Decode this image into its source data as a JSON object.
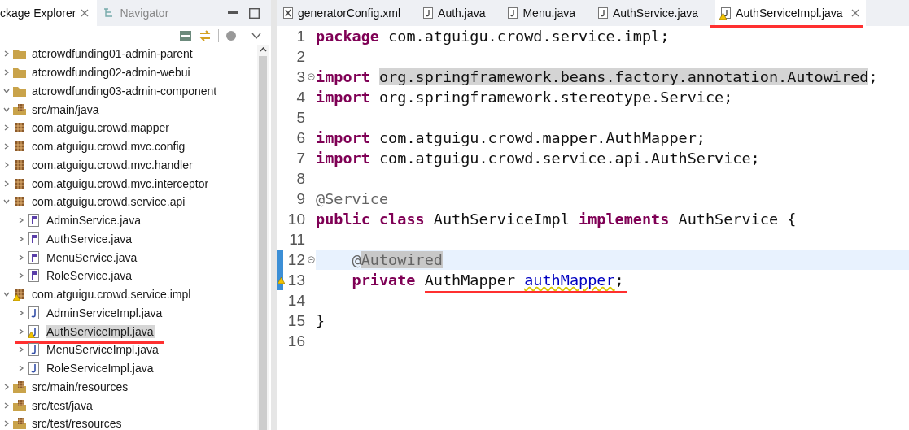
{
  "explorer": {
    "tabs": [
      {
        "label": "ckage Explorer",
        "selected": true
      },
      {
        "label": "Navigator",
        "selected": false
      }
    ],
    "tree": [
      {
        "label": "atcrowdfunding01-admin-parent",
        "kind": "project",
        "expanded": false,
        "selected": false
      },
      {
        "label": "atcrowdfunding02-admin-webui",
        "kind": "project",
        "expanded": false,
        "selected": false
      },
      {
        "label": "atcrowdfunding03-admin-component",
        "kind": "project",
        "expanded": true,
        "selected": false,
        "children": [
          {
            "label": "src/main/java",
            "kind": "source",
            "expanded": true,
            "selected": false,
            "children": [
              {
                "label": "com.atguigu.crowd.mapper",
                "kind": "package",
                "expanded": false,
                "selected": false
              },
              {
                "label": "com.atguigu.crowd.mvc.config",
                "kind": "package",
                "expanded": false,
                "selected": false
              },
              {
                "label": "com.atguigu.crowd.mvc.handler",
                "kind": "package",
                "expanded": false,
                "selected": false
              },
              {
                "label": "com.atguigu.crowd.mvc.interceptor",
                "kind": "package",
                "expanded": false,
                "selected": false
              },
              {
                "label": "com.atguigu.crowd.service.api",
                "kind": "package",
                "expanded": true,
                "selected": false,
                "children": [
                  {
                    "label": "AdminService.java",
                    "kind": "interface",
                    "expanded": false,
                    "selected": false
                  },
                  {
                    "label": "AuthService.java",
                    "kind": "interface",
                    "expanded": false,
                    "selected": false
                  },
                  {
                    "label": "MenuService.java",
                    "kind": "interface",
                    "expanded": false,
                    "selected": false
                  },
                  {
                    "label": "RoleService.java",
                    "kind": "interface",
                    "expanded": false,
                    "selected": false
                  }
                ]
              },
              {
                "label": "com.atguigu.crowd.service.impl",
                "kind": "package",
                "expanded": true,
                "selected": false,
                "warning": true,
                "children": [
                  {
                    "label": "AdminServiceImpl.java",
                    "kind": "class",
                    "expanded": false,
                    "selected": false
                  },
                  {
                    "label": "AuthServiceImpl.java",
                    "kind": "class",
                    "expanded": false,
                    "selected": true,
                    "warning": true,
                    "underlined": true
                  },
                  {
                    "label": "MenuServiceImpl.java",
                    "kind": "class",
                    "expanded": false,
                    "selected": false
                  },
                  {
                    "label": "RoleServiceImpl.java",
                    "kind": "class",
                    "expanded": false,
                    "selected": false
                  }
                ]
              }
            ]
          },
          {
            "label": "src/main/resources",
            "kind": "source",
            "expanded": false,
            "selected": false
          },
          {
            "label": "src/test/java",
            "kind": "source",
            "expanded": false,
            "selected": false
          },
          {
            "label": "src/test/resources",
            "kind": "source",
            "expanded": false,
            "selected": false
          }
        ]
      }
    ]
  },
  "editor": {
    "tabs": [
      {
        "label": "generatorConfig.xml",
        "kind": "xml",
        "selected": false
      },
      {
        "label": "Auth.java",
        "kind": "java",
        "selected": false
      },
      {
        "label": "Menu.java",
        "kind": "java",
        "selected": false
      },
      {
        "label": "AuthService.java",
        "kind": "java",
        "selected": false
      },
      {
        "label": "AuthServiceImpl.java",
        "kind": "java",
        "selected": true,
        "warning": true,
        "underlined": true
      }
    ],
    "lines": [
      {
        "number": "1",
        "tokens": [
          {
            "kind": "keyword",
            "text": "package"
          },
          {
            "kind": "text",
            "text": " com.atguigu.crowd.service.impl;"
          }
        ]
      },
      {
        "number": "2"
      },
      {
        "number": "3",
        "fold": true,
        "tokens": [
          {
            "kind": "keyword",
            "text": "import "
          },
          {
            "kind": "occurrence",
            "text": "org.springframework.beans.factory.annotation.Autowired"
          },
          {
            "kind": "text",
            "text": ";"
          }
        ]
      },
      {
        "number": "4",
        "tokens": [
          {
            "kind": "keyword",
            "text": "import"
          },
          {
            "kind": "text",
            "text": " org.springframework.stereotype.Service;"
          }
        ]
      },
      {
        "number": "5"
      },
      {
        "number": "6",
        "tokens": [
          {
            "kind": "keyword",
            "text": "import"
          },
          {
            "kind": "text",
            "text": " com.atguigu.crowd.mapper.AuthMapper;"
          }
        ]
      },
      {
        "number": "7",
        "tokens": [
          {
            "kind": "keyword",
            "text": "import"
          },
          {
            "kind": "text",
            "text": " com.atguigu.crowd.service.api.AuthService;"
          }
        ]
      },
      {
        "number": "8"
      },
      {
        "number": "9",
        "tokens": [
          {
            "kind": "annotation",
            "text": "@Service"
          }
        ]
      },
      {
        "number": "10",
        "tokens": [
          {
            "kind": "keyword",
            "text": "public "
          },
          {
            "kind": "keyword",
            "text": "class "
          },
          {
            "kind": "text",
            "text": "AuthServiceImpl "
          },
          {
            "kind": "keyword",
            "text": "implements "
          },
          {
            "kind": "text",
            "text": "AuthService {"
          }
        ]
      },
      {
        "number": "11"
      },
      {
        "number": "12",
        "fold": true,
        "current": true,
        "range": true,
        "indent": true,
        "tokens": [
          {
            "kind": "annotation",
            "text": "@"
          },
          {
            "kind": "occurrence-annotation",
            "text": "Autowired"
          }
        ]
      },
      {
        "number": "13",
        "range": true,
        "warning": true,
        "indent": true,
        "tokens": [
          {
            "kind": "keyword",
            "text": "private "
          },
          {
            "kind": "underlined",
            "text": "AuthMapper "
          },
          {
            "kind": "field-underlined",
            "text": "authMapper"
          },
          {
            "kind": "underlined",
            "text": ";"
          }
        ]
      },
      {
        "number": "14"
      },
      {
        "number": "15",
        "tokens": [
          {
            "kind": "text",
            "text": "}"
          }
        ]
      },
      {
        "number": "16"
      }
    ]
  }
}
